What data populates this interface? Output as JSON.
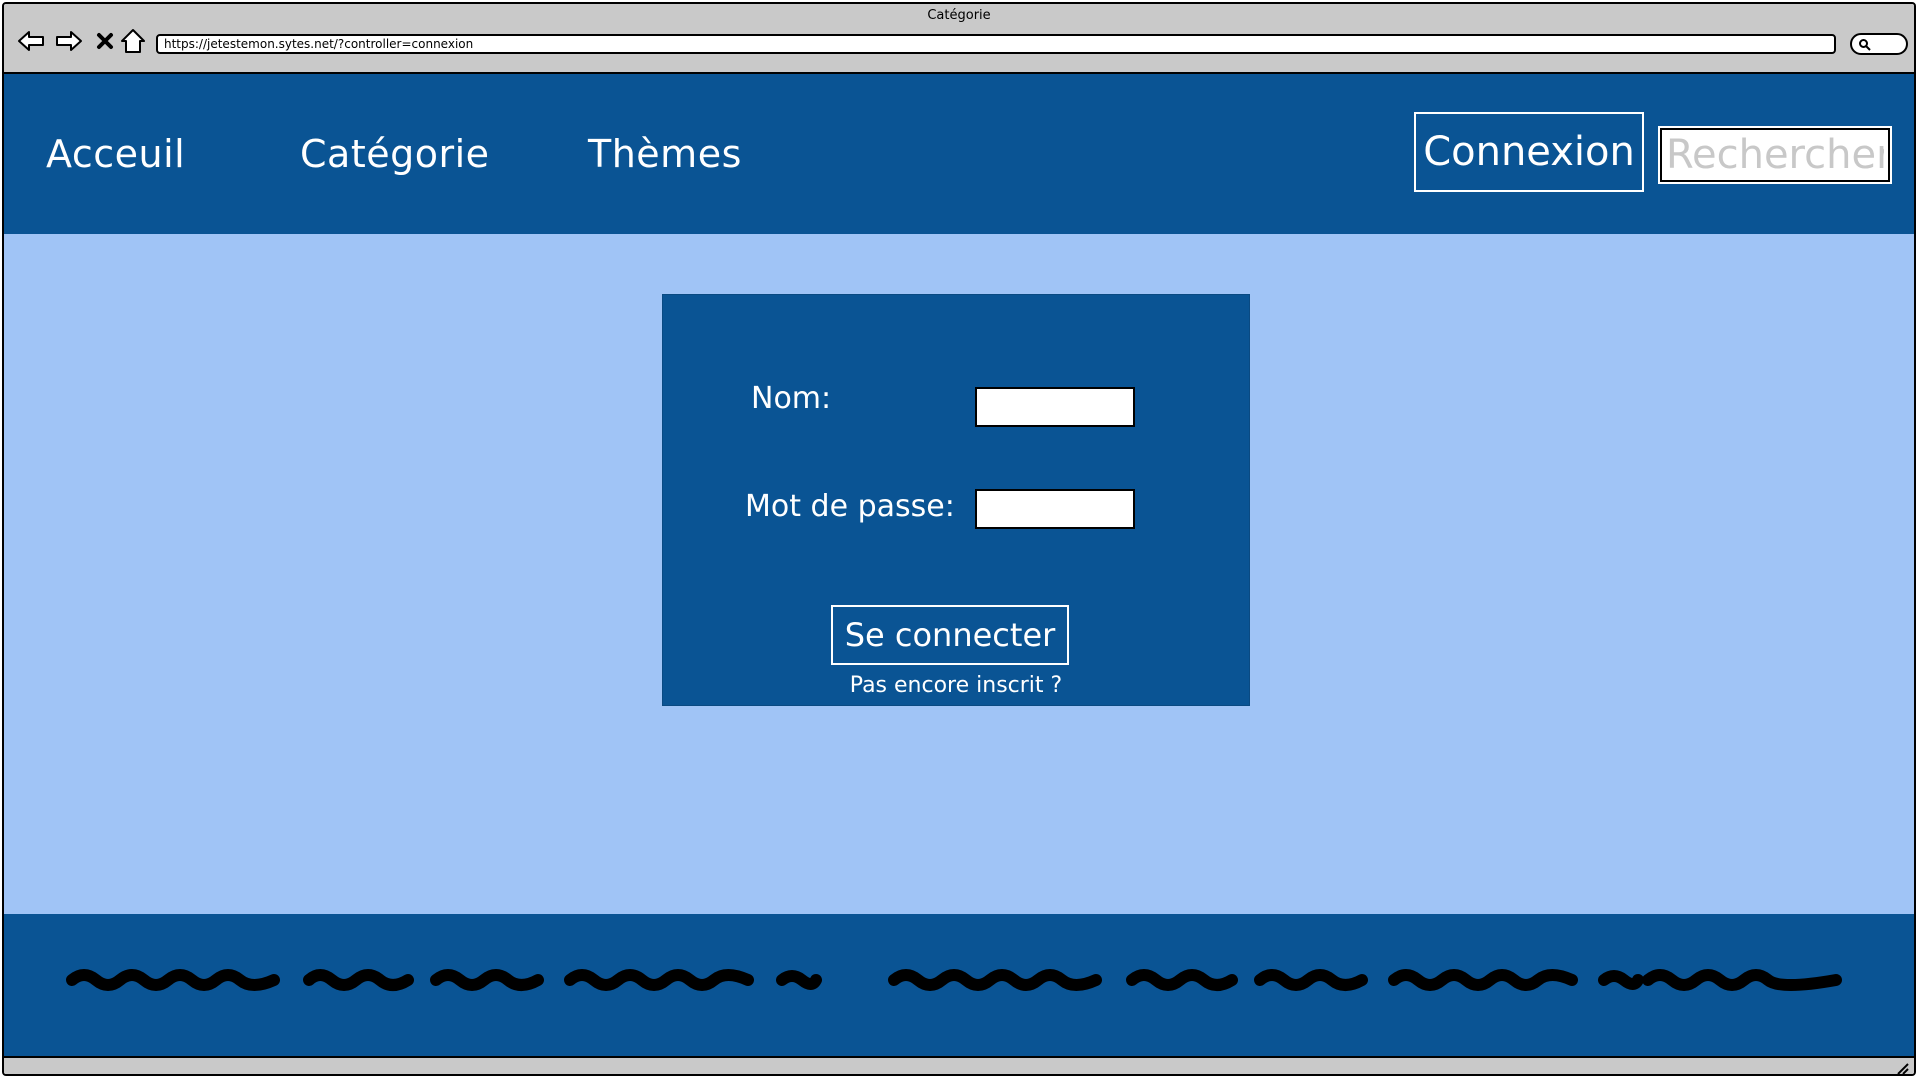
{
  "window": {
    "title": "Catégorie",
    "url": "https://jetestemon.sytes.net/?controller=connexion"
  },
  "header": {
    "nav": [
      {
        "label": "Acceuil"
      },
      {
        "label": "Catégorie"
      },
      {
        "label": "Thèmes"
      }
    ],
    "connexion_label": "Connexion",
    "search_placeholder": "Rechercher"
  },
  "login": {
    "name_label": "Nom:",
    "name_value": "",
    "password_label": "Mot de passe:",
    "password_value": "",
    "submit_label": "Se connecter",
    "signup_link": "Pas encore inscrit ?"
  },
  "colors": {
    "header_bg": "#0a5494",
    "main_bg": "#a0c4f6",
    "chrome_bg": "#c9c9c9"
  },
  "icons": [
    "back-arrow-icon",
    "forward-arrow-icon",
    "stop-icon",
    "home-icon",
    "search-icon",
    "resize-grip-icon"
  ]
}
